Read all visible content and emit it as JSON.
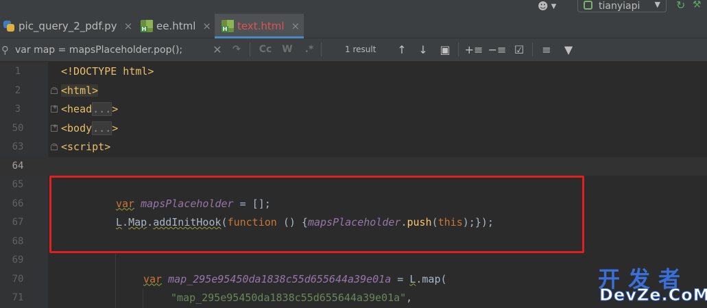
{
  "tabs": [
    {
      "label": "pic_query_2_pdf.py",
      "icon": "python-file-icon",
      "active": false
    },
    {
      "label": "ee.html",
      "icon": "html-file-icon",
      "active": false
    },
    {
      "label": "text.html",
      "icon": "html-file-icon",
      "active": true
    }
  ],
  "toolbar": {
    "branch": "tianyiapi",
    "close_glyph": "×"
  },
  "find": {
    "query": "var map = mapsPlaceholder.pop();",
    "match_case_label": "Cc",
    "words_label": "W",
    "regex_label": ".*",
    "result": "1 result"
  },
  "editor": {
    "line_numbers": [
      "1",
      "2",
      "3",
      "50",
      "63",
      "64",
      "65",
      "66",
      "67",
      "68",
      "69",
      "70",
      "71"
    ],
    "doctype": "<!DOCTYPE html>",
    "fold_placeholder": "...",
    "line66": {
      "kw": "var",
      "name": "mapsPlaceholder",
      "rest": " = [];"
    },
    "line67": {
      "obj": "L",
      "cls": "Map",
      "method": "addInitHook",
      "fnkw": "function",
      "mid": " () {",
      "name": "mapsPlaceholder",
      "push": "push",
      "thiskw": "this",
      "end": ");});"
    },
    "line70": {
      "kw": "var",
      "name": "map_295e95450da1838c55d655644a39e01a",
      "eq": " = ",
      "obj": "L",
      "method": "map",
      "paren": "("
    },
    "line71": {
      "str": "\"map_295e95450da1838c55d655644a39e01a\"",
      "comma": ","
    }
  },
  "watermark": {
    "cn": "开发者",
    "en": "DevZe.CoM"
  },
  "colors": {
    "keyword": "#cc7832",
    "variable": "#9876aa",
    "function": "#ffc66d",
    "string": "#6a8759",
    "tag": "#e8bf6a",
    "annotation": "#e02020",
    "active_tab_text": "#e05252"
  }
}
